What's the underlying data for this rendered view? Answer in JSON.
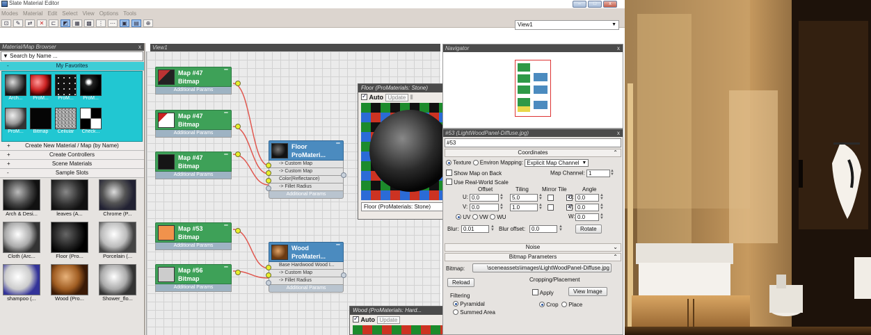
{
  "window": {
    "title": "Slate Material Editor"
  },
  "menu": [
    "Modes",
    "Material",
    "Edit",
    "Select",
    "View",
    "Options",
    "Tools"
  ],
  "toolbar": {
    "view_select": "View1"
  },
  "browser": {
    "title": "Material/Map Browser",
    "close": "x",
    "search_placeholder": "Search by Name ...",
    "favorites_label": "My Favorites",
    "favorites": [
      "Arch...",
      "ProM...",
      "ProM...",
      "ProM...",
      "ProM...",
      "Bitmap",
      "Cellular",
      "Check..."
    ],
    "groups": [
      {
        "sym": "+",
        "label": "Create New Material / Map (by Name)"
      },
      {
        "sym": "+",
        "label": "Create Controllers"
      },
      {
        "sym": "+",
        "label": "Scene Materials"
      },
      {
        "sym": "-",
        "label": "Sample Slots"
      }
    ],
    "sample_slots": [
      "Arch & Desi...",
      "leaves (A...",
      "Chrome (P...",
      "Cloth (Arc...",
      "Floor (Pro...",
      "Porcelain (...",
      "shampoo (...",
      "Wood (Pro...",
      "Shower_flo..."
    ]
  },
  "view": {
    "tab": "View1",
    "nodes": [
      {
        "title": "Map #47",
        "sub": "Bitmap",
        "row": "Additional Params"
      },
      {
        "title": "Map #47",
        "sub": "Bitmap",
        "row": "Additional Params"
      },
      {
        "title": "Map #47",
        "sub": "Bitmap",
        "row": "Additional Params"
      },
      {
        "title": "Map #53",
        "sub": "Bitmap",
        "row": "Additional Params"
      },
      {
        "title": "Map #56",
        "sub": "Bitmap",
        "row": "Additional Params"
      }
    ],
    "floor_node": {
      "title": "Floor",
      "sub": "ProMateri...",
      "rows": [
        "-> Custom Map",
        "-> Custom Map",
        "Color(Reflectance)",
        "-> Fillet Radius"
      ],
      "footer": "Additional Params"
    },
    "wood_node": {
      "title": "Wood",
      "sub": "ProMateri...",
      "rows": [
        "Base Hardwood Wood I...",
        "-> Custom Map",
        "-> Fillet Radius"
      ],
      "footer": "Additional Params"
    }
  },
  "preview_floor": {
    "title": "Floor (ProMaterials: Stone)",
    "auto": "Auto",
    "update": "Update",
    "select": "Floor (ProMaterials: Stone)"
  },
  "preview_wood": {
    "title": "Wood (ProMaterials: Hard...",
    "auto": "Auto",
    "update": "Update"
  },
  "navigator": {
    "title": "Navigator"
  },
  "params": {
    "title": "#53 (LightWoodPanel-Diffuse.jpg)",
    "name_field": "#53",
    "coordinates": "Coordinates",
    "texture": "Texture",
    "environ": "Environ",
    "mapping_label": "Mapping:",
    "mapping_value": "Explicit Map Channel",
    "show_map_on_back": "Show Map on Back",
    "map_channel_label": "Map Channel:",
    "map_channel": "1",
    "real_world": "Use Real-World Scale",
    "offset_hdr": "Offset",
    "tiling_hdr": "Tiling",
    "mirror_tile_hdr": "Mirror Tile",
    "angle_hdr": "Angle",
    "u_label": "U:",
    "v_label": "V:",
    "w_label": "W:",
    "u_offset": "0.0",
    "u_tiling": "5.0",
    "u_angle": "0.0",
    "v_offset": "0.0",
    "v_tiling": "1.0",
    "v_angle": "0.0",
    "w_angle": "0.0",
    "uv": "UV",
    "vw": "VW",
    "wu": "WU",
    "blur_label": "Blur:",
    "blur": "0.01",
    "blur_offset_label": "Blur offset:",
    "blur_offset": "0.0",
    "rotate": "Rotate",
    "noise": "Noise",
    "bitmap_params": "Bitmap Parameters",
    "bitmap_label": "Bitmap:",
    "bitmap_path": "\\sceneassets\\images\\LightWoodPanel-Diffuse.jpg",
    "reload": "Reload",
    "cropping": "Cropping/Placement",
    "apply": "Apply",
    "view_image": "View Image",
    "filtering": "Filtering",
    "pyramidal": "Pyramidal",
    "summed_area": "Summed Area",
    "crop": "Crop",
    "place": "Place"
  }
}
